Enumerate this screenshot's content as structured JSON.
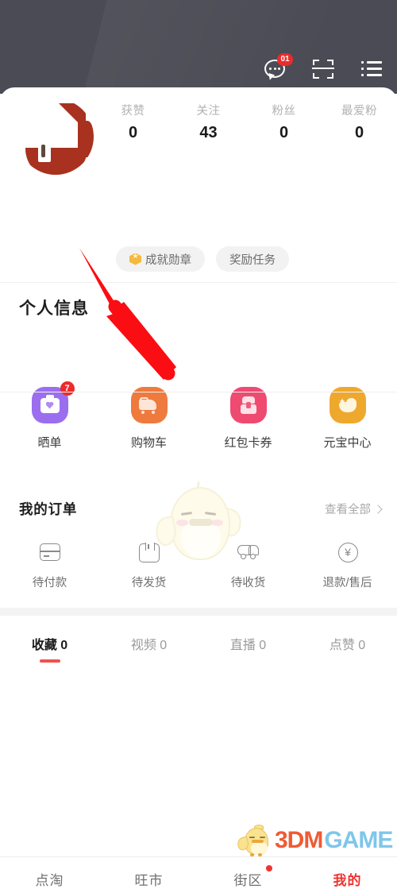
{
  "header": {
    "icons": [
      {
        "name": "message-icon",
        "label": "消息",
        "badge": "01"
      },
      {
        "name": "scan-icon",
        "label": "扫一扫"
      },
      {
        "name": "menu-icon",
        "label": "菜单"
      }
    ]
  },
  "profile": {
    "avatar_alt": "用户头像",
    "stats": [
      {
        "label": "获赞",
        "value": "0"
      },
      {
        "label": "关注",
        "value": "43"
      },
      {
        "label": "粉丝",
        "value": "0"
      },
      {
        "label": "最爱粉",
        "value": "0"
      }
    ],
    "pills": [
      {
        "label": "成就勋章",
        "icon": "medal-icon"
      },
      {
        "label": "奖励任务",
        "icon": null
      }
    ],
    "section_title": "个人信息"
  },
  "quick_entries": [
    {
      "label": "晒单",
      "badge": "7",
      "color": "#9b6ef0",
      "icon": "camera-heart-icon"
    },
    {
      "label": "购物车",
      "badge": null,
      "color": "#ef7a3d",
      "icon": "shopping-cart-icon"
    },
    {
      "label": "红包卡券",
      "badge": null,
      "color": "#ef4a70",
      "icon": "red-envelope-icon"
    },
    {
      "label": "元宝中心",
      "badge": null,
      "color": "#efa82e",
      "icon": "ingot-icon"
    }
  ],
  "orders": {
    "title": "我的订单",
    "view_all": "查看全部",
    "view_all_icon": "chevron-right-icon",
    "items": [
      {
        "label": "待付款",
        "icon": "payment-card-icon"
      },
      {
        "label": "待发货",
        "icon": "package-box-icon"
      },
      {
        "label": "待收货",
        "icon": "delivery-truck-icon"
      },
      {
        "label": "退款/售后",
        "icon": "yen-refund-icon"
      }
    ]
  },
  "content_tabs": [
    {
      "label": "收藏 0",
      "active": true
    },
    {
      "label": "视频 0",
      "active": false
    },
    {
      "label": "直播 0",
      "active": false
    },
    {
      "label": "点赞 0",
      "active": false
    }
  ],
  "bottom_nav": [
    {
      "label": "点淘",
      "active": false,
      "dot": false
    },
    {
      "label": "旺市",
      "active": false,
      "dot": false
    },
    {
      "label": "街区",
      "active": false,
      "dot": true
    },
    {
      "label": "我的",
      "active": true,
      "dot": false
    }
  ],
  "watermark": {
    "text_primary": "3DM",
    "text_secondary": "GAME"
  },
  "annotation": {
    "arrow_name": "red-pointer-arrow",
    "points_to": "个人信息"
  },
  "colors": {
    "header_bg": "#4b4b55",
    "accent_red": "#f0332e",
    "tab_underline": "#f0514f",
    "badge_red": "#ec2b2b"
  }
}
